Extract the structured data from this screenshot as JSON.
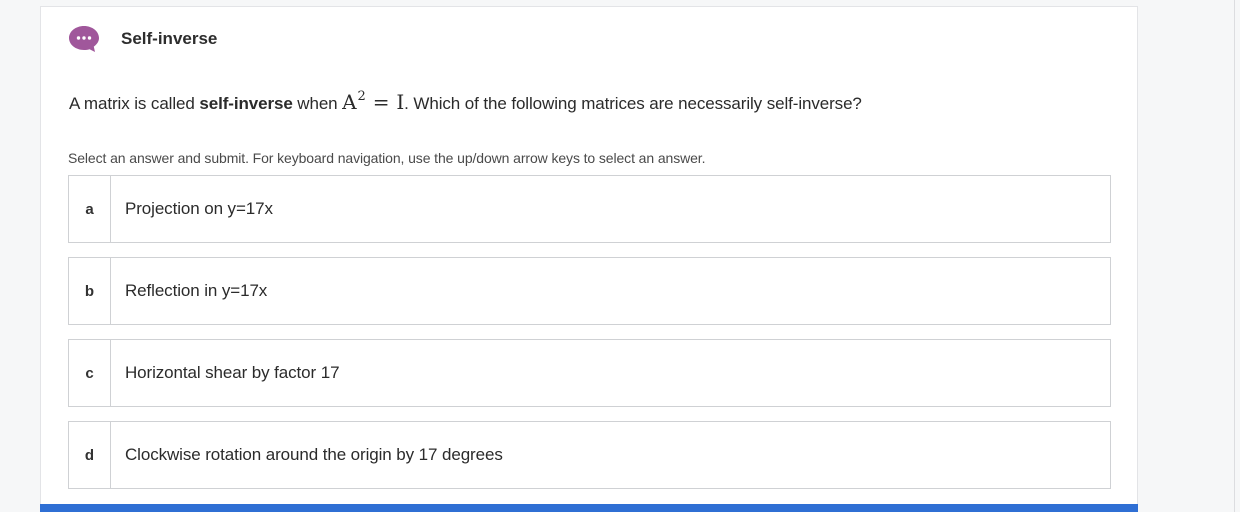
{
  "header": {
    "icon": "chat-bubble-icon",
    "icon_color": "#a0579b",
    "title": "Self-inverse"
  },
  "question": {
    "prefix": "A matrix is called ",
    "term": "self-inverse",
    "middle": " when ",
    "math_base": "A",
    "math_exp": "2",
    "math_eq": "=",
    "math_rhs": "I",
    "suffix": ". Which of the following matrices are necessarily self-inverse?"
  },
  "instructions": "Select an answer and submit. For keyboard navigation, use the up/down arrow keys to select an answer.",
  "options": [
    {
      "letter": "a",
      "text": "Projection on y=17x"
    },
    {
      "letter": "b",
      "text": "Reflection in y=17x"
    },
    {
      "letter": "c",
      "text": "Horizontal shear by factor 17"
    },
    {
      "letter": "d",
      "text": "Clockwise rotation around the origin by 17 degrees"
    }
  ],
  "colors": {
    "accent_bar": "#2f6fd4",
    "icon": "#a0579b"
  }
}
